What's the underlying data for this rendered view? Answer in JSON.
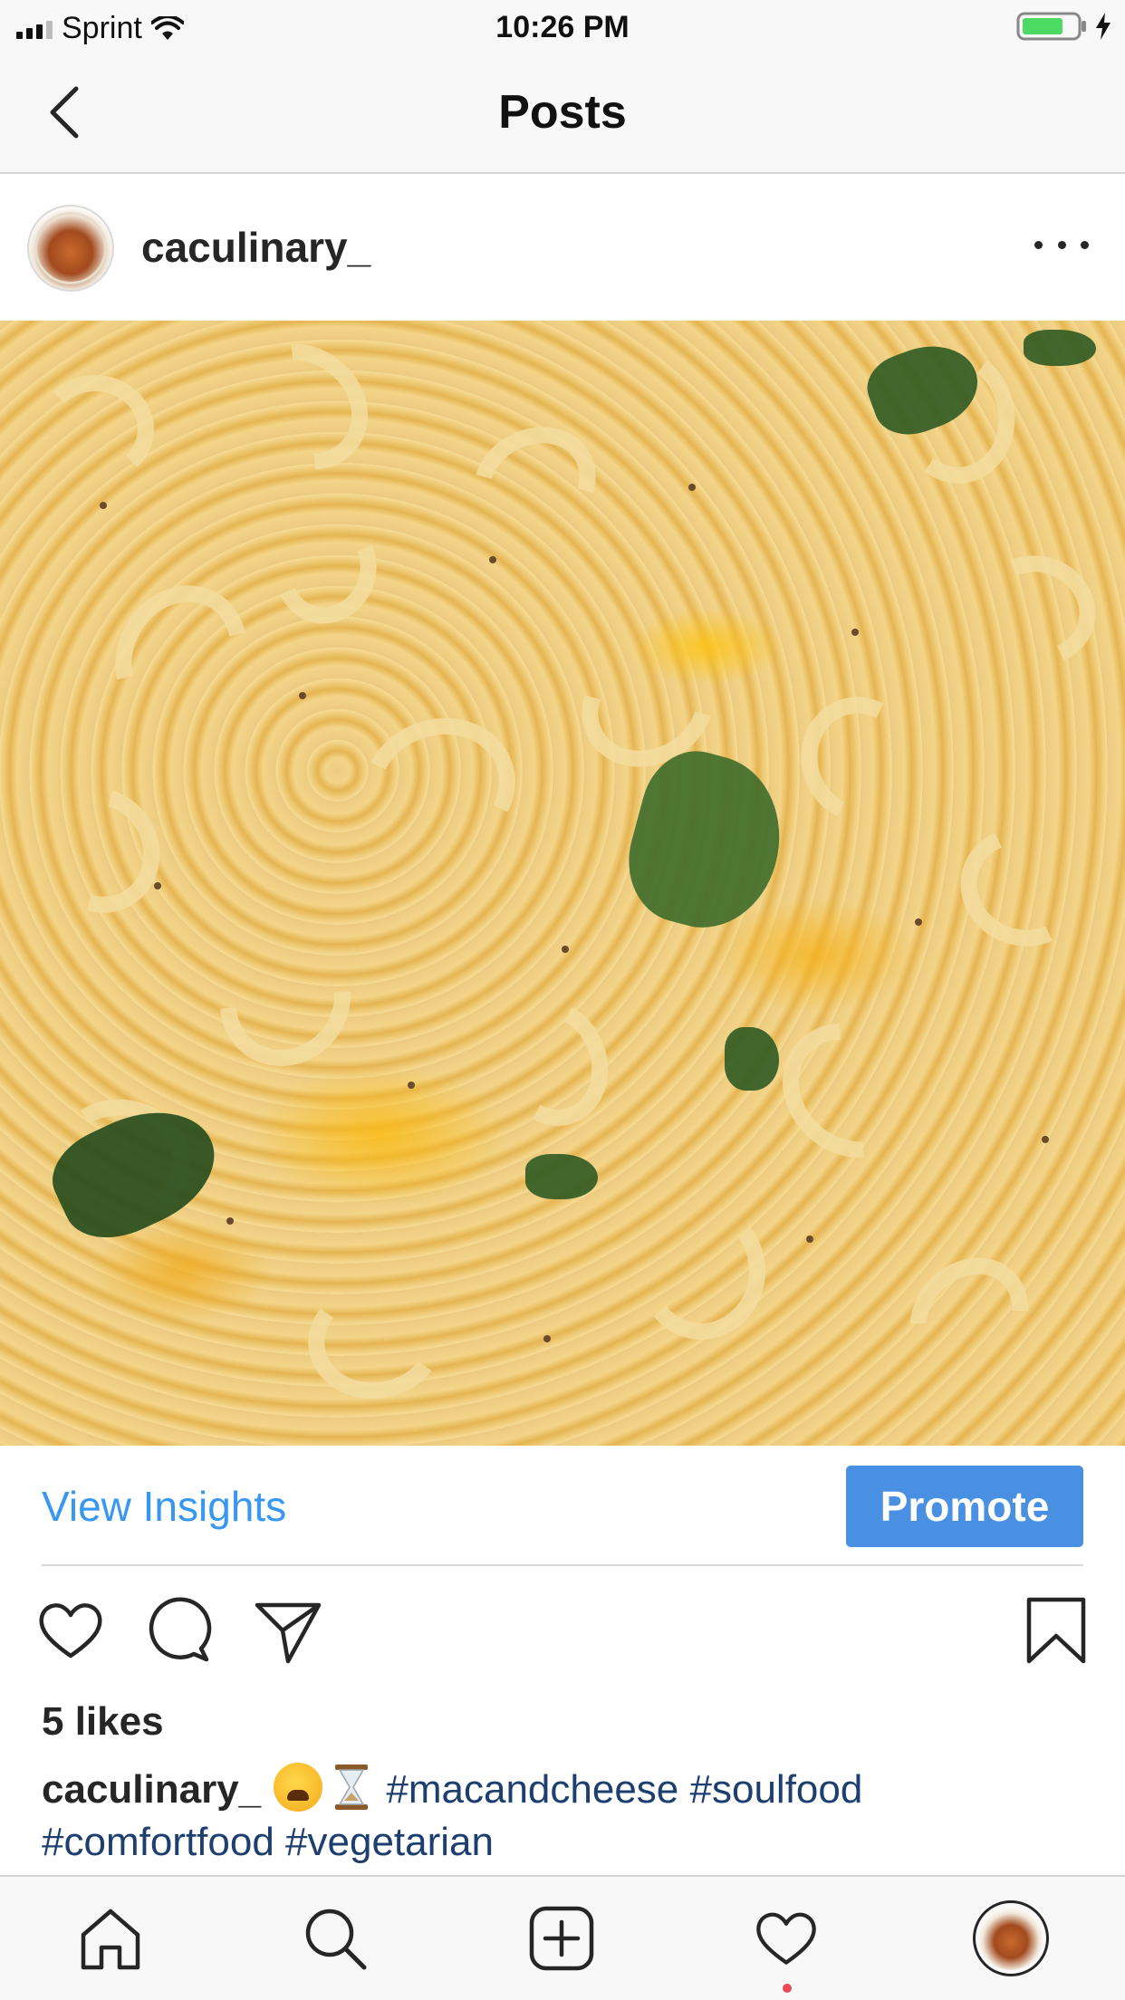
{
  "status_bar": {
    "carrier": "Sprint",
    "time": "10:26 PM",
    "icons": [
      "signal-icon",
      "wifi-icon",
      "battery-icon",
      "charging-icon"
    ]
  },
  "nav": {
    "title": "Posts",
    "back_icon": "chevron-left-icon"
  },
  "post": {
    "username": "caculinary_",
    "more_icon": "more-horizontal-icon",
    "insights_label": "View Insights",
    "promote_label": "Promote",
    "likes_text": "5 likes",
    "caption": {
      "username": "caculinary_",
      "emojis": [
        "weary-face",
        "hourglass"
      ],
      "hashtags": [
        "#macandcheese",
        "#soulfood",
        "#comfortfood",
        "#vegetarian"
      ]
    }
  },
  "actions": [
    "heart-icon",
    "comment-icon",
    "share-icon",
    "bookmark-icon"
  ],
  "tab_bar": {
    "tabs": [
      "home-icon",
      "search-icon",
      "add-post-icon",
      "activity-heart-icon",
      "profile-avatar"
    ],
    "activity_has_notification": true
  },
  "colors": {
    "accent_blue": "#3897f0",
    "promote_blue": "#4a90e2",
    "hashtag_navy": "#1c3f70",
    "notification_red": "#ed4956"
  }
}
